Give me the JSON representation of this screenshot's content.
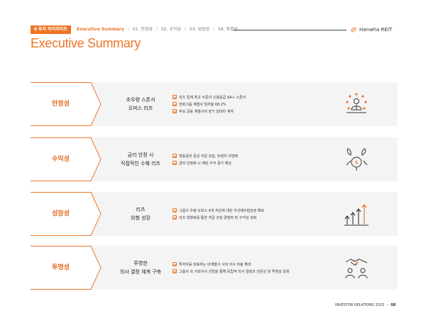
{
  "header": {
    "section_tag": "Ⅱ 투자 하이라이트",
    "breadcrumbs": [
      {
        "label": "Executive Summary"
      },
      {
        "label": "01. 안정성"
      },
      {
        "label": "02. 수익성"
      },
      {
        "label": "03. 성장성"
      },
      {
        "label": "04. 투명성"
      }
    ],
    "brand": "Hanwha REIT"
  },
  "title": "Executive Summary",
  "rows": [
    {
      "category": "안정성",
      "subject_lines": [
        "초우량 스폰서",
        "오피스 리츠"
      ],
      "points": [
        "리츠 업계 최고 수준의 신용등급 AA+ 스폰서",
        "한화그룹 계열사 임차율 68.2%",
        "주요 금융 계열사의 장기 임대차 계약"
      ],
      "icon": "people-network-icon"
    },
    {
      "category": "수익성",
      "subject_lines": [
        "금리 안정 시",
        "직접적인 수혜 리츠"
      ],
      "points": [
        "변동금리 중심 자금 조달, 트랜치 다변화",
        "금리 안정화 시 배당 수익 증가 예상"
      ],
      "icon": "money-growth-icon"
    },
    {
      "category": "성장성",
      "subject_lines": [
        "리츠",
        "외형 성장"
      ],
      "points": [
        "그룹사 우량 오피스 4개 자산에 대한 우선매수협상권 확보",
        "리츠 대형화를 통한 자금 조달 경쟁력 및 수익성 강화"
      ],
      "icon": "growth-arrows-icon"
    },
    {
      "category": "투명성",
      "subject_lines": [
        "투명한",
        "의사 결정 체계 구축"
      ],
      "points": [
        "투자자를 대표하는 비계열사 사외 이사 비율 확대",
        "그룹사 외 사외이사 선임을 통해 독립적 의사 결정과 전문성 및 투명성 강화"
      ],
      "icon": "handshake-icon"
    }
  ],
  "footer": {
    "label": "INVESTOR RELATIONS 2023",
    "page": "08"
  },
  "colors": {
    "accent": "#ee7526",
    "row_background": "#f4f4f4"
  }
}
